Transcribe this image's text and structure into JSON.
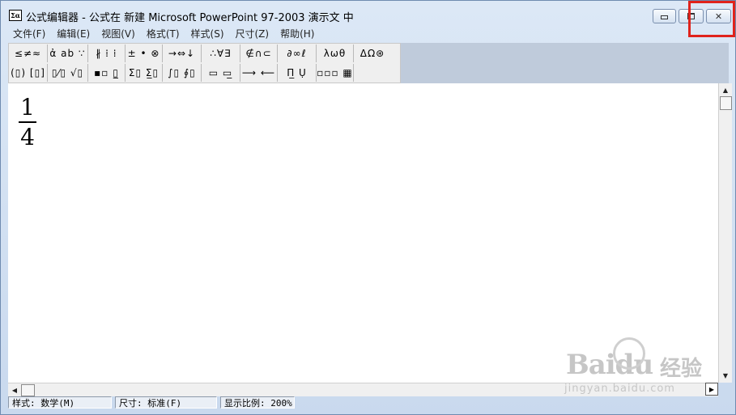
{
  "window": {
    "title": "公式编辑器 - 公式在 新建 Microsoft PowerPoint 97-2003 演示文 中",
    "icon_glyph": "Σα"
  },
  "menu": [
    {
      "label": "文件(F)"
    },
    {
      "label": "编辑(E)"
    },
    {
      "label": "视图(V)"
    },
    {
      "label": "格式(T)"
    },
    {
      "label": "样式(S)"
    },
    {
      "label": "尺寸(Z)"
    },
    {
      "label": "帮助(H)"
    }
  ],
  "toolbar": {
    "row1": [
      {
        "name": "relations-palette",
        "glyph": "≤≠≈"
      },
      {
        "name": "spaces-ellipses-palette",
        "glyph": "ἀ ab ∵"
      },
      {
        "name": "embellishments-palette",
        "glyph": "∦ ⁞ ⁞"
      },
      {
        "name": "operators-palette",
        "glyph": "± • ⊗"
      },
      {
        "name": "arrows-palette",
        "glyph": "→⇔↓"
      },
      {
        "name": "logic-palette",
        "glyph": "∴∀∃"
      },
      {
        "name": "set-theory-palette",
        "glyph": "∉∩⊂"
      },
      {
        "name": "misc-symbols-palette",
        "glyph": "∂∞ℓ"
      },
      {
        "name": "greek-lower-palette",
        "glyph": "λωθ"
      },
      {
        "name": "greek-upper-palette",
        "glyph": "ΔΩ⊛"
      }
    ],
    "row2": [
      {
        "name": "fences-palette",
        "glyph": "(▯) [▯]"
      },
      {
        "name": "fraction-radical-palette",
        "glyph": "▯⁄▯ √▯"
      },
      {
        "name": "subscript-superscript-palette",
        "glyph": "▪▫ ▯̲"
      },
      {
        "name": "summation-palette",
        "glyph": "Σ▯ Σ̲▯"
      },
      {
        "name": "integral-palette",
        "glyph": "∫▯ ∮▯"
      },
      {
        "name": "underbar-overbar-palette",
        "glyph": "▭ ▭̲"
      },
      {
        "name": "labeled-arrow-palette",
        "glyph": "⟶ ⟵"
      },
      {
        "name": "products-palette",
        "glyph": "Π̲ Ụ"
      },
      {
        "name": "matrix-palette",
        "glyph": "▫▫▫ ▦"
      }
    ]
  },
  "editor": {
    "fraction": {
      "numerator": "1",
      "denominator": "4"
    }
  },
  "scrollbars": {
    "up": "▲",
    "down": "▼",
    "left": "◀",
    "right": "▶"
  },
  "status": {
    "style": "样式: 数学(M)",
    "size": "尺寸: 标准(F)",
    "zoom": "显示比例: 200%"
  },
  "watermark": {
    "brand": "Baidu",
    "cn": "经验",
    "url": "jingyan.baidu.com"
  },
  "colors": {
    "highlight": "#e0231c",
    "title_bar": "#dce8f6"
  }
}
